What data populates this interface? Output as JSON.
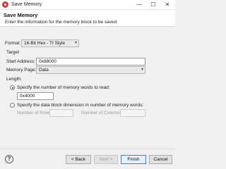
{
  "window": {
    "title": "Save Memory",
    "min": "—",
    "max": "☐",
    "close": "✕"
  },
  "header": {
    "title": "Save Memory",
    "description": "Enter the information for the memory block to be saved"
  },
  "format": {
    "label": "Format:",
    "value": "16-Bit Hex - TI Style"
  },
  "target": {
    "group_label": "Target",
    "start_address_label": "Start Address:",
    "start_address_value": "0x88000",
    "memory_page_label": "Memory Page:",
    "memory_page_value": "Data"
  },
  "length": {
    "group_label": "Length:",
    "option_words_label": "Specify the number of memory words to read:",
    "option_words_value": "0x4000",
    "option_words_selected": true,
    "option_block_label": "Specify the data block dimension in number of memory words:",
    "rows_label": "Number of Rows:",
    "rows_value": "",
    "columns_label": "Number of Columns:",
    "columns_value": ""
  },
  "buttons": {
    "help": "?",
    "back": "< Back",
    "next": "Next >",
    "finish": "Finish",
    "cancel": "Cancel"
  },
  "icons": {
    "app": "ti-app-icon",
    "dropdown": "chevron-down-icon",
    "help": "help-icon"
  }
}
